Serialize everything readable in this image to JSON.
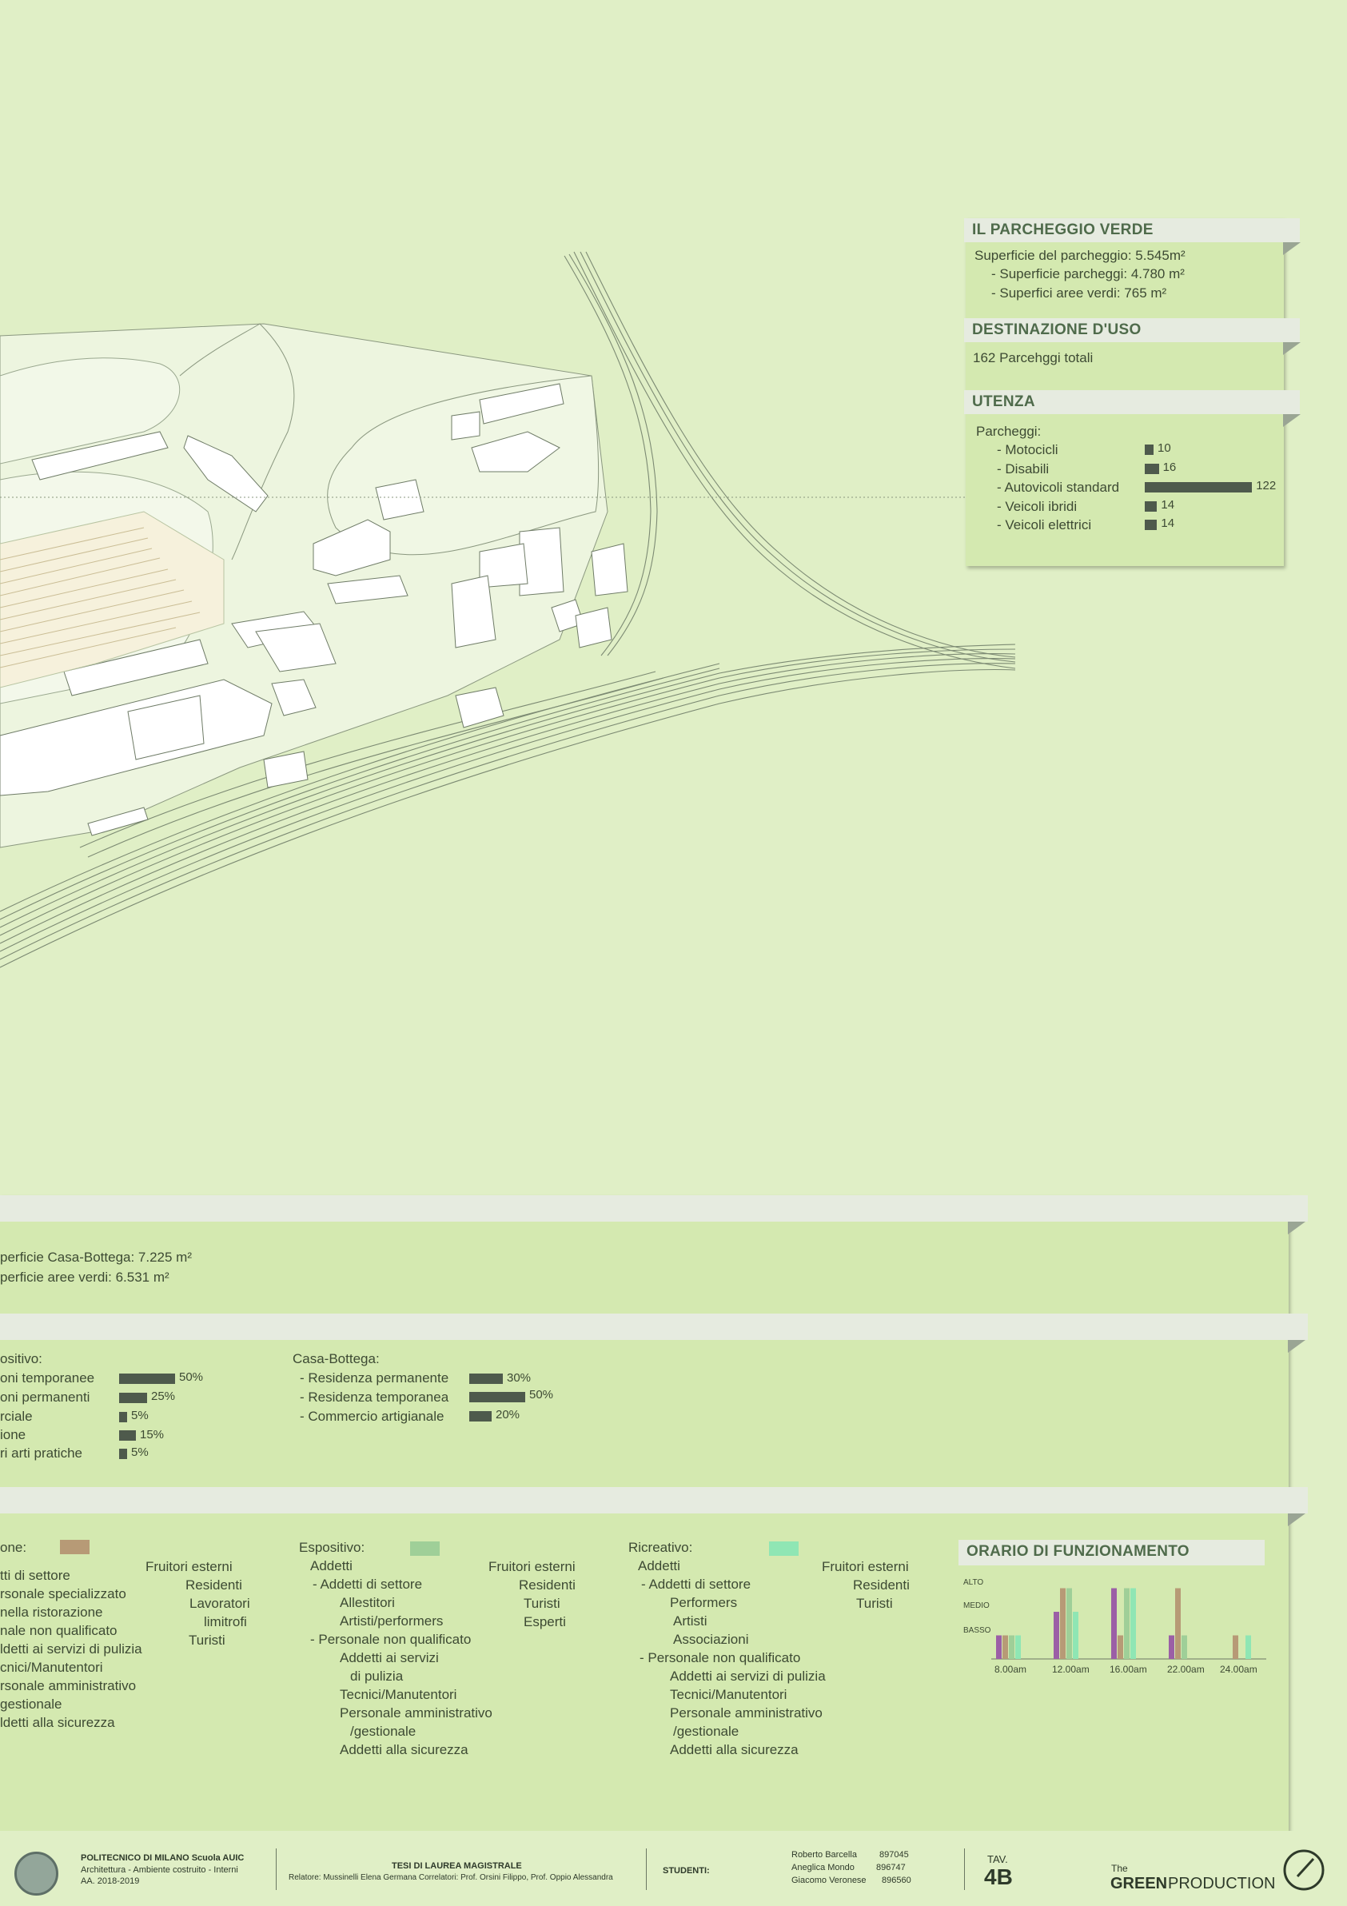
{
  "parcheggio": {
    "title": "IL PARCHEGGIO VERDE",
    "superficie": "Superficie del parcheggio: 5.545m²",
    "sup_parcheggi": "- Superficie parcheggi: 4.780 m²",
    "sup_verdi": "- Superfici aree verdi: 765 m²",
    "dest_title": "DESTINAZIONE D'USO",
    "dest_text": "162 Parcehggi totali",
    "utenza_title": "UTENZA",
    "utenza_label": "Parcheggi:",
    "utenza": [
      {
        "label": "- Motocicli",
        "value": "10",
        "v": 10
      },
      {
        "label": "- Disabili",
        "value": "16",
        "v": 16
      },
      {
        "label": "- Autovicoli standard",
        "value": "122",
        "v": 122
      },
      {
        "label": "- Veicoli ibridi",
        "value": "14",
        "v": 14
      },
      {
        "label": "- Veicoli elettrici",
        "value": "14",
        "v": 14
      }
    ]
  },
  "casa": {
    "sup1": "perficie Casa-Bottega: 7.225 m²",
    "sup2": "perficie aree verdi: 6.531 m²",
    "espositivo_label": "ositivo:",
    "espositivo": [
      {
        "label": "oni temporanee",
        "value": "50%",
        "v": 50
      },
      {
        "label": "oni permanenti",
        "value": "25%",
        "v": 25
      },
      {
        "label": "rciale",
        "value": "5%",
        "v": 5
      },
      {
        "label": "ione",
        "value": "15%",
        "v": 15
      },
      {
        "label": "ri arti pratiche",
        "value": "5%",
        "v": 5
      }
    ],
    "cb_label": "Casa-Bottega:",
    "cb": [
      {
        "label": "- Residenza permanente",
        "value": "30%",
        "v": 30
      },
      {
        "label": "- Residenza temporanea",
        "value": "50%",
        "v": 50
      },
      {
        "label": "- Commercio artigianale",
        "value": "20%",
        "v": 20
      }
    ]
  },
  "users": {
    "col1_title": "one:",
    "col1_lines": [
      "tti di settore",
      "rsonale specializzato",
      "nella ristorazione",
      "",
      "nale non qualificato",
      "ldetti ai servizi di pulizia",
      "cnici/Manutentori",
      "rsonale amministrativo",
      "gestionale",
      "ldetti alla sicurezza"
    ],
    "col1_ext": [
      "Fruitori esterni",
      "Residenti",
      "Lavoratori",
      "limitrofi",
      "Turisti"
    ],
    "col2_title": "Espositivo:",
    "col2_lines": [
      "Addetti",
      "- Addetti di settore",
      "Allestitori",
      "Artisti/performers",
      "",
      "- Personale non qualificato",
      "Addetti ai servizi",
      "di pulizia",
      "Tecnici/Manutentori",
      "Personale amministrativo",
      "/gestionale",
      "Addetti alla sicurezza"
    ],
    "col2_ext": [
      "Fruitori esterni",
      "Residenti",
      "Turisti",
      "Esperti"
    ],
    "col3_title": "Ricreativo:",
    "col3_lines": [
      "Addetti",
      "- Addetti di settore",
      "Performers",
      "Artisti",
      "Associazioni",
      "",
      "- Personale non qualificato",
      "Addetti ai servizi di pulizia",
      "Tecnici/Manutentori",
      "Personale amministrativo",
      "/gestionale",
      "Addetti alla sicurezza"
    ],
    "col3_ext": [
      "Fruitori esterni",
      "Residenti",
      "Turisti"
    ],
    "colors": {
      "col1": "#b79a76",
      "col2": "#9fcf98",
      "col3": "#8fe6b4"
    }
  },
  "orario": {
    "title": "ORARIO DI FUNZIONAMENTO",
    "levels": [
      "ALTO",
      "MEDIO",
      "BASSO"
    ]
  },
  "chart_data": {
    "type": "bar",
    "title": "ORARIO DI FUNZIONAMENTO",
    "categories": [
      "8.00am",
      "12.00am",
      "16.00am",
      "22.00am",
      "24.00am"
    ],
    "y_levels": [
      "BASSO",
      "MEDIO",
      "ALTO"
    ],
    "ylim": [
      0,
      3
    ],
    "series": [
      {
        "color": "#9b5fa6",
        "values": [
          1,
          2,
          3,
          1,
          0
        ]
      },
      {
        "color": "#b79a76",
        "values": [
          1,
          3,
          1,
          3,
          1
        ]
      },
      {
        "color": "#9fcf98",
        "values": [
          1,
          3,
          3,
          1,
          0
        ]
      },
      {
        "color": "#8fe6b4",
        "values": [
          1,
          2,
          3,
          0,
          1
        ]
      }
    ]
  },
  "footer": {
    "uni": "POLITECNICO DI MILANO Scuola AUIC",
    "course": "Architettura - Ambiente costruito - Interni",
    "year": "AA. 2018-2019",
    "thesis": "TESI DI LAUREA MAGISTRALE",
    "relatore": "Relatore: Mussinelli Elena Germana Correlatori: Prof. Orsini Filippo, Prof. Oppio Alessandra",
    "studenti": "STUDENTI:",
    "students": [
      {
        "name": "Roberto Barcella",
        "id": "897045"
      },
      {
        "name": "Aneglica Mondo",
        "id": "896747"
      },
      {
        "name": "Giacomo Veronese",
        "id": "896560"
      }
    ],
    "tav_label": "TAV.",
    "tav": "4B",
    "brand_the": "The",
    "brand_green": "GREEN",
    "brand_prod": "PRODUCTION"
  }
}
